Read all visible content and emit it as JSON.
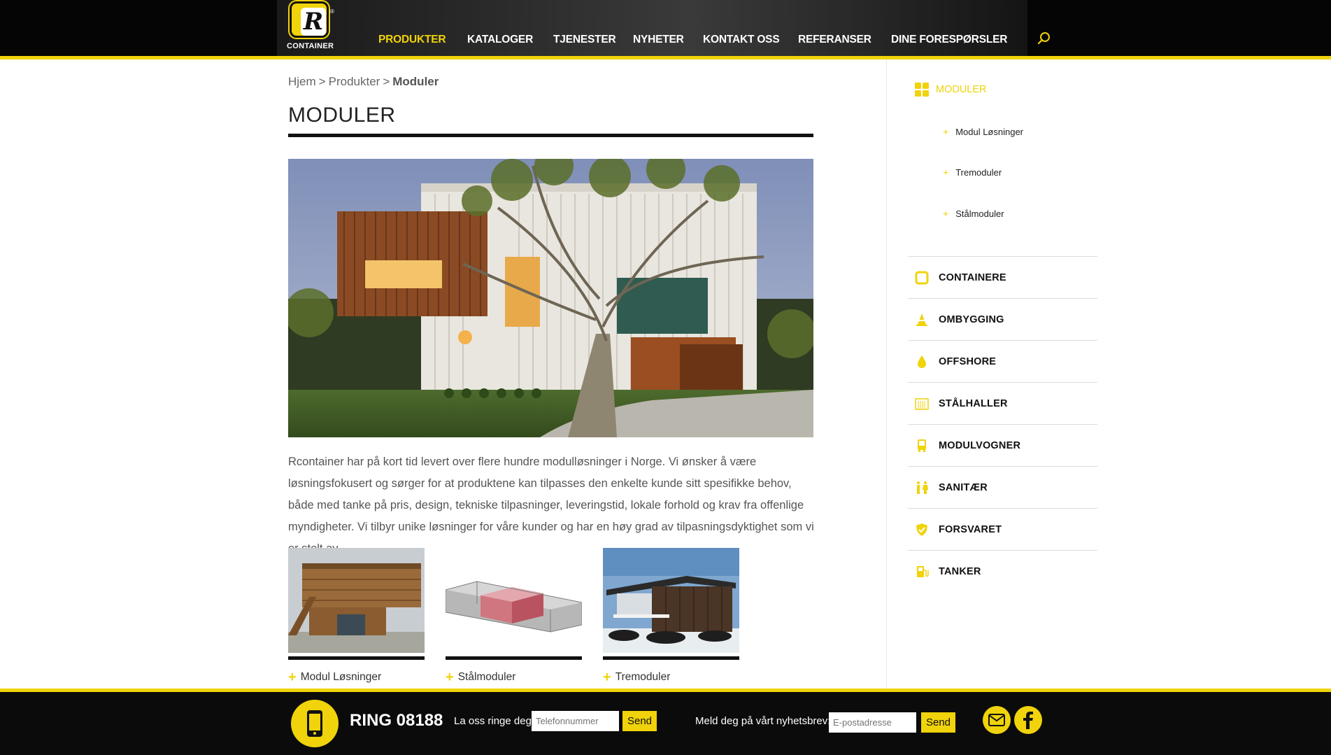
{
  "header": {
    "logo_text": "CONTAINER",
    "logo_letter": "R",
    "logo_reg": "®",
    "nav": [
      {
        "label": "PRODUKTER",
        "active": true
      },
      {
        "label": "KATALOGER",
        "active": false
      },
      {
        "label": "TJENESTER",
        "active": false
      },
      {
        "label": "NYHETER",
        "active": false
      },
      {
        "label": "KONTAKT OSS",
        "active": false
      },
      {
        "label": "REFERANSER",
        "active": false
      },
      {
        "label": "DINE FORESPØRSLER",
        "active": false
      }
    ],
    "search_icon": "search-icon"
  },
  "breadcrumb": {
    "items": [
      "Hjem",
      "Produkter",
      "Moduler"
    ],
    "separator": ">"
  },
  "main": {
    "title": "MODULER",
    "intro": "Rcontainer har på kort tid levert over flere hundre modulløsninger i Norge. Vi ønsker å være løsningsfokusert og sørger for at produktene kan tilpasses den enkelte kunde sitt spesifikke behov, både med tanke på pris, design, tekniske tilpasninger, leveringstid, lokale forhold og krav fra offenlige myndigheter. Vi tilbyr unike løsninger for våre kunder og har en høy grad av tilpasningsdyktighet som vi er stolt av.",
    "thumbnails": [
      {
        "label": "Modul Løsninger"
      },
      {
        "label": "Stålmoduler"
      },
      {
        "label": "Tremoduler"
      }
    ],
    "plus": "+"
  },
  "sidebar": {
    "active": {
      "label": "MODULER",
      "icon": "grid-icon"
    },
    "sub_items": [
      "Modul Løsninger",
      "Tremoduler",
      "Stålmoduler"
    ],
    "items": [
      {
        "label": "CONTAINERE",
        "icon": "container-icon"
      },
      {
        "label": "OMBYGGING",
        "icon": "cone-icon"
      },
      {
        "label": "OFFSHORE",
        "icon": "drop-icon"
      },
      {
        "label": "STÅLHALLER",
        "icon": "hall-icon"
      },
      {
        "label": "MODULVOGNER",
        "icon": "wagon-icon"
      },
      {
        "label": "SANITÆR",
        "icon": "restroom-icon"
      },
      {
        "label": "FORSVARET",
        "icon": "shield-icon"
      },
      {
        "label": "TANKER",
        "icon": "fuel-icon"
      }
    ]
  },
  "footer": {
    "ring": "RING 08188",
    "call_label": "La oss ringe deg:",
    "phone_placeholder": "Telefonnummer",
    "send_label": "Send",
    "newsletter_label": "Meld deg på vårt nyhetsbrev:",
    "email_placeholder": "E-postadresse"
  },
  "colors": {
    "accent": "#f0d30a",
    "dark": "#0b0b0b",
    "text": "#555555"
  }
}
